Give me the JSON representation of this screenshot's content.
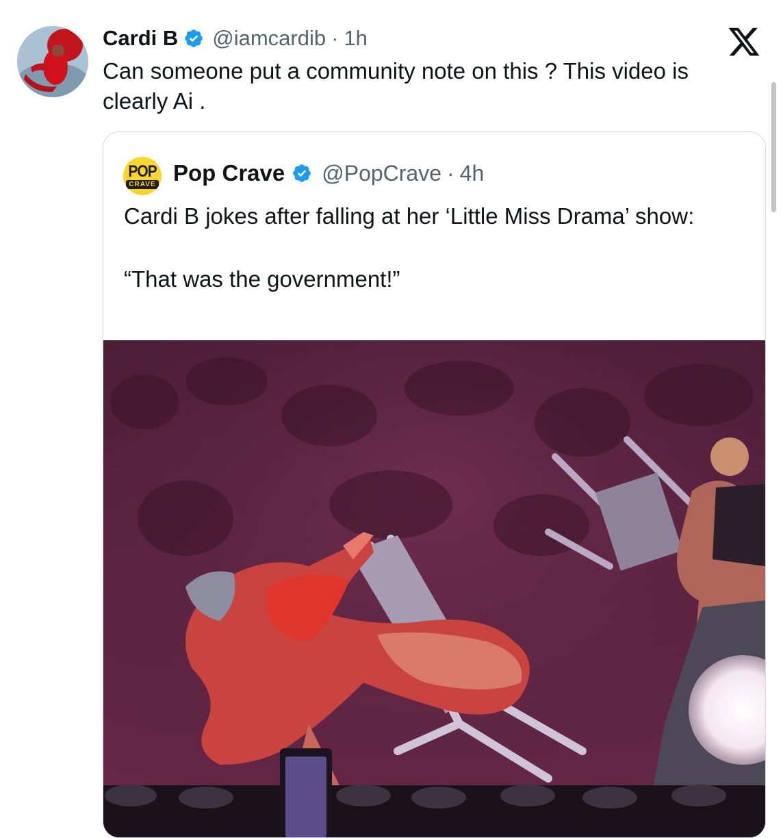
{
  "tweet": {
    "author": {
      "display_name": "Cardi B",
      "handle": "@iamcardib",
      "verified": true,
      "avatar_icon": "profile-photo-icon"
    },
    "separator": "·",
    "time": "1h",
    "text": "Can someone put a community note on this ? This video is clearly Ai ."
  },
  "app": {
    "logo_icon": "x-logo-icon"
  },
  "quoted_tweet": {
    "author": {
      "display_name": "Pop Crave",
      "handle": "@PopCrave",
      "verified": true,
      "avatar_top": "POP",
      "avatar_bottom": "CRAVE"
    },
    "separator": "·",
    "time": "4h",
    "text_line_1": "Cardi B jokes after falling at her ‘Little Miss Drama’ show:",
    "text_line_2": "“That was the government!”",
    "media_icon": "video-thumbnail-icon"
  },
  "colors": {
    "verified_blue": "#1d9bf0",
    "text_primary": "#0f1419",
    "text_muted": "#536471",
    "card_border": "#cfd9de",
    "pop_crave_yellow": "#fbd52c"
  }
}
